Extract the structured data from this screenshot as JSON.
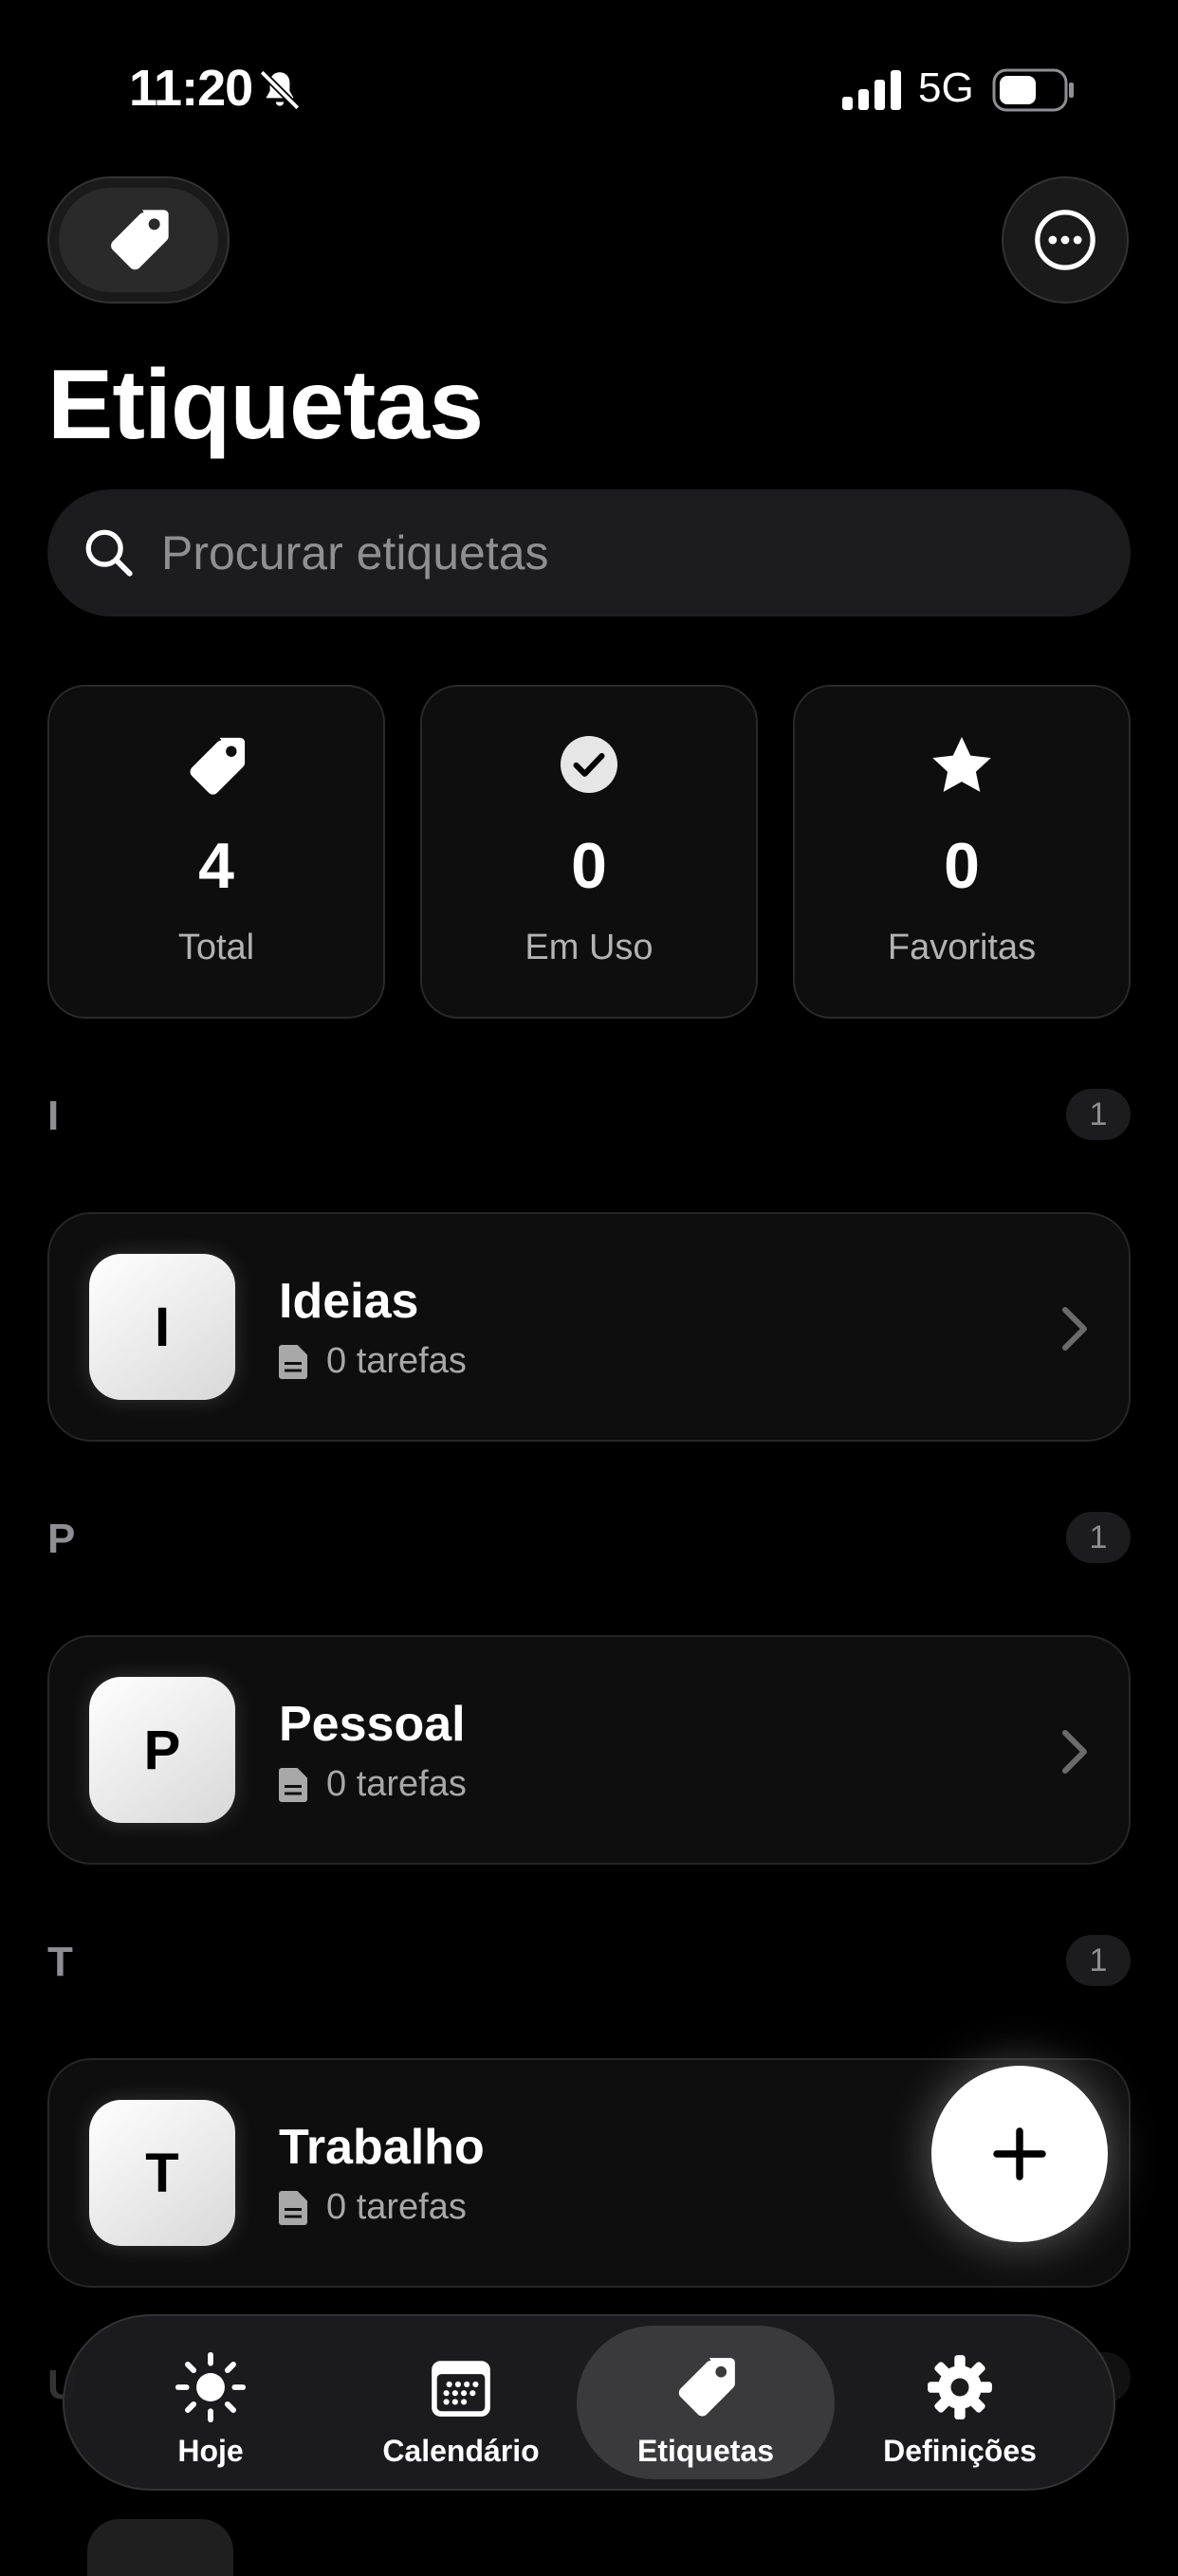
{
  "status_bar": {
    "time": "11:20",
    "network": "5G"
  },
  "header": {
    "title": "Etiquetas"
  },
  "search": {
    "placeholder": "Procurar etiquetas"
  },
  "stats": [
    {
      "value": "4",
      "label": "Total",
      "icon": "tag-icon"
    },
    {
      "value": "0",
      "label": "Em Uso",
      "icon": "check-circle-icon"
    },
    {
      "value": "0",
      "label": "Favoritas",
      "icon": "star-icon"
    }
  ],
  "sections": [
    {
      "letter": "I",
      "count": "1",
      "item": {
        "initial": "I",
        "name": "Ideias",
        "tasks": "0 tarefas"
      }
    },
    {
      "letter": "P",
      "count": "1",
      "item": {
        "initial": "P",
        "name": "Pessoal",
        "tasks": "0 tarefas"
      }
    },
    {
      "letter": "T",
      "count": "1",
      "item": {
        "initial": "T",
        "name": "Trabalho",
        "tasks": "0 tarefas"
      }
    }
  ],
  "tabs": [
    {
      "label": "Hoje",
      "icon": "sun-icon"
    },
    {
      "label": "Calendário",
      "icon": "calendar-icon"
    },
    {
      "label": "Etiquetas",
      "icon": "tag-icon",
      "active": true
    },
    {
      "label": "Definições",
      "icon": "gear-icon"
    }
  ]
}
